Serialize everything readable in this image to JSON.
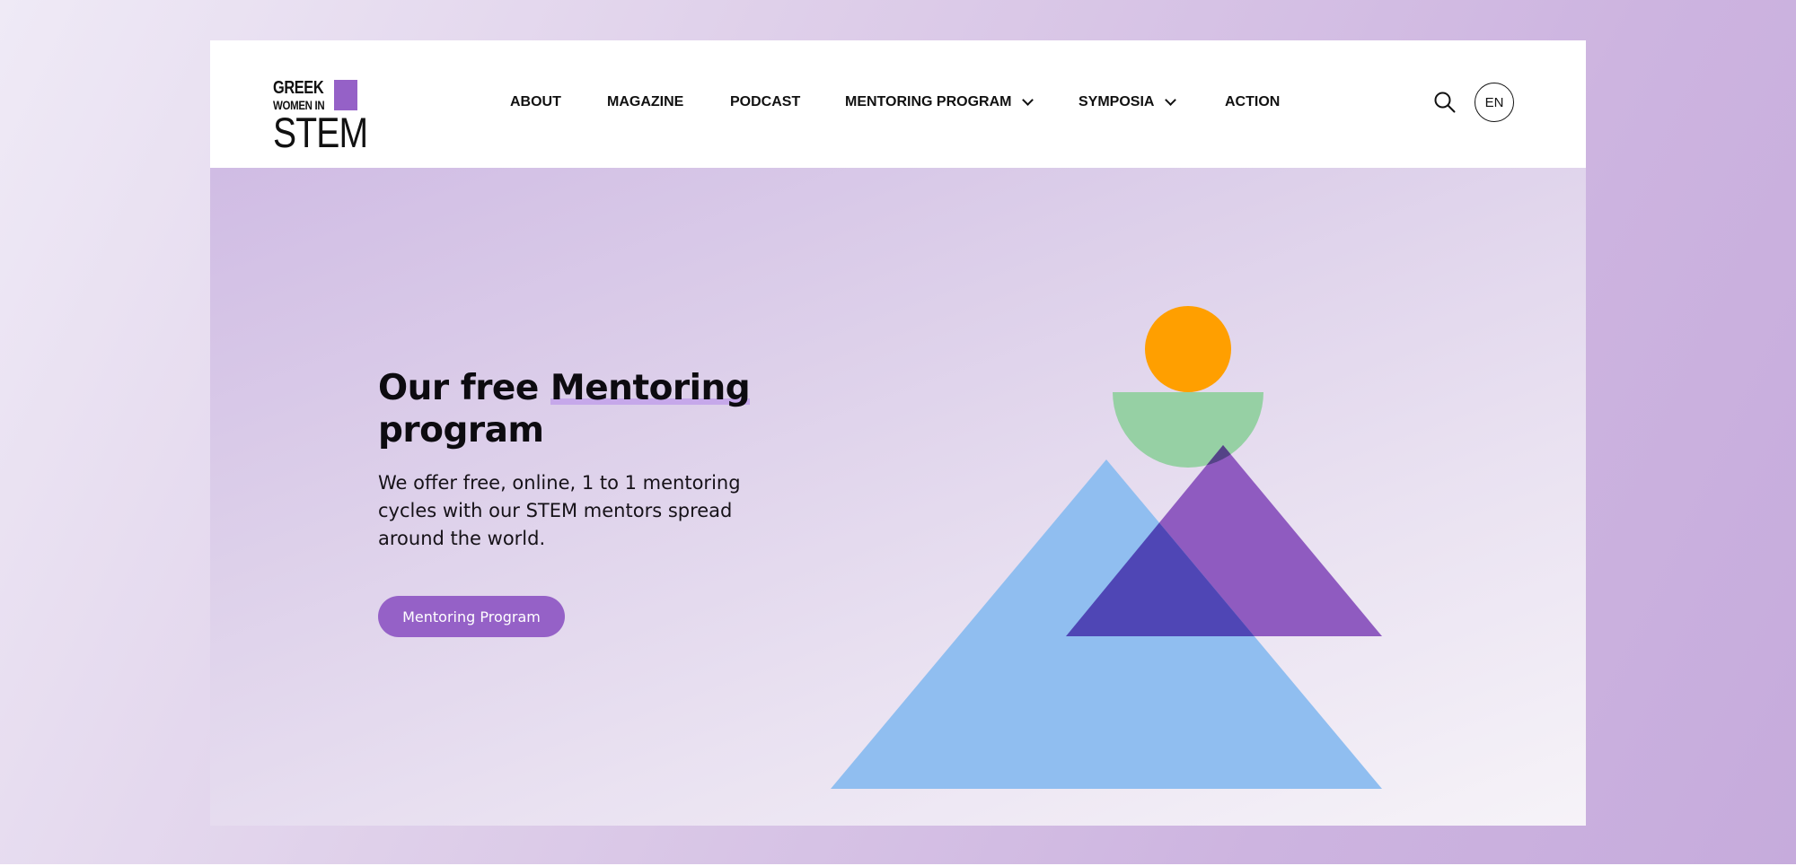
{
  "logo": {
    "line1": "GREEK",
    "line2": "WOMEN IN",
    "line3": "STEM",
    "accent_color": "#9561c7"
  },
  "nav": {
    "items": [
      {
        "label": "ABOUT"
      },
      {
        "label": "MAGAZINE"
      },
      {
        "label": "PODCAST"
      },
      {
        "label": "MENTORING PROGRAM",
        "has_dropdown": true
      },
      {
        "label": "SYMPOSIA",
        "has_dropdown": true
      },
      {
        "label": "ACTION"
      }
    ],
    "search_icon": "search-icon",
    "language": "EN"
  },
  "hero": {
    "title_prefix": "Our free ",
    "title_highlight": "Mentoring",
    "title_suffix": "program",
    "description": "We offer free, online, 1 to 1 mentoring cycles with our STEM mentors spread around the world.",
    "cta_label": "Mentoring Program",
    "colors": {
      "button": "#9561c7",
      "highlight": "#c6a8ea",
      "circle": "#ff9f00",
      "semicircle": "#96d0a4",
      "purple_triangle": "#8f5bc0",
      "blue_triangle": "#90bef0",
      "overlap": "#4f46b5"
    }
  }
}
